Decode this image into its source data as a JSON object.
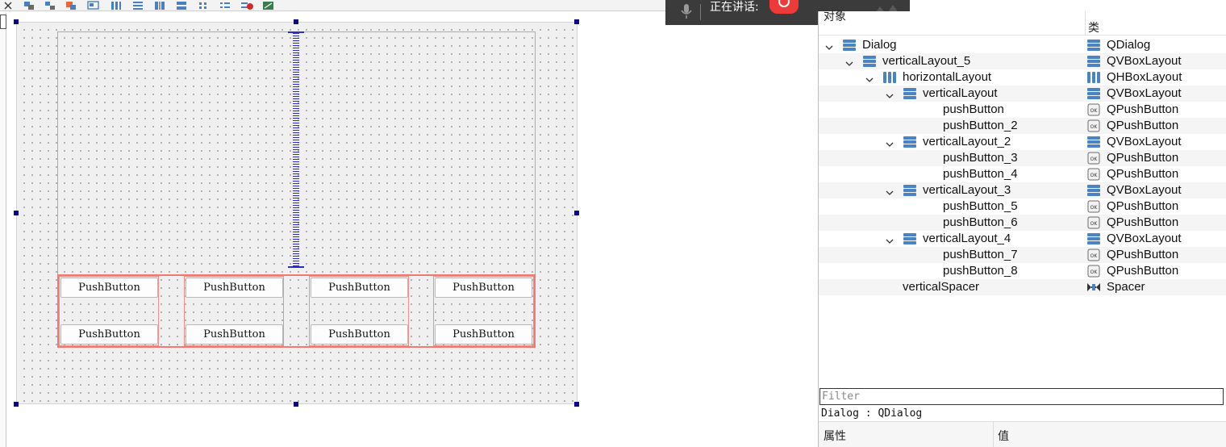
{
  "overlay": {
    "speaking_label": "正在讲话:"
  },
  "object_inspector": {
    "column_object": "对象",
    "column_class": "类",
    "rows": [
      {
        "name": "Dialog",
        "cls": "QDialog",
        "icon": "vbox-layout-icon",
        "cls_icon": "vbox-layout-icon",
        "depth": 0,
        "expanded": true
      },
      {
        "name": "verticalLayout_5",
        "cls": "QVBoxLayout",
        "icon": "vbox-layout-icon",
        "cls_icon": "vbox-layout-icon",
        "depth": 1,
        "expanded": true
      },
      {
        "name": "horizontalLayout",
        "cls": "QHBoxLayout",
        "icon": "hbox-layout-icon",
        "cls_icon": "hbox-layout-icon",
        "depth": 2,
        "expanded": true
      },
      {
        "name": "verticalLayout",
        "cls": "QVBoxLayout",
        "icon": "vbox-layout-icon",
        "cls_icon": "vbox-layout-icon",
        "depth": 3,
        "expanded": true
      },
      {
        "name": "pushButton",
        "cls": "QPushButton",
        "icon": "",
        "cls_icon": "ok-button-icon",
        "depth": 4
      },
      {
        "name": "pushButton_2",
        "cls": "QPushButton",
        "icon": "",
        "cls_icon": "ok-button-icon",
        "depth": 4
      },
      {
        "name": "verticalLayout_2",
        "cls": "QVBoxLayout",
        "icon": "vbox-layout-icon",
        "cls_icon": "vbox-layout-icon",
        "depth": 3,
        "expanded": true
      },
      {
        "name": "pushButton_3",
        "cls": "QPushButton",
        "icon": "",
        "cls_icon": "ok-button-icon",
        "depth": 4
      },
      {
        "name": "pushButton_4",
        "cls": "QPushButton",
        "icon": "",
        "cls_icon": "ok-button-icon",
        "depth": 4
      },
      {
        "name": "verticalLayout_3",
        "cls": "QVBoxLayout",
        "icon": "vbox-layout-icon",
        "cls_icon": "vbox-layout-icon",
        "depth": 3,
        "expanded": true
      },
      {
        "name": "pushButton_5",
        "cls": "QPushButton",
        "icon": "",
        "cls_icon": "ok-button-icon",
        "depth": 4
      },
      {
        "name": "pushButton_6",
        "cls": "QPushButton",
        "icon": "",
        "cls_icon": "ok-button-icon",
        "depth": 4
      },
      {
        "name": "verticalLayout_4",
        "cls": "QVBoxLayout",
        "icon": "vbox-layout-icon",
        "cls_icon": "vbox-layout-icon",
        "depth": 3,
        "expanded": true
      },
      {
        "name": "pushButton_7",
        "cls": "QPushButton",
        "icon": "",
        "cls_icon": "ok-button-icon",
        "depth": 4
      },
      {
        "name": "pushButton_8",
        "cls": "QPushButton",
        "icon": "",
        "cls_icon": "ok-button-icon",
        "depth": 4
      },
      {
        "name": "verticalSpacer",
        "cls": "Spacer",
        "icon": "",
        "cls_icon": "spacer-icon",
        "depth": 2
      }
    ]
  },
  "filter": {
    "placeholder": "Filter"
  },
  "selected_object": "Dialog : QDialog",
  "property_editor": {
    "column_property": "属性",
    "column_value": "值"
  },
  "form": {
    "buttons": [
      "PushButton",
      "PushButton",
      "PushButton",
      "PushButton",
      "PushButton",
      "PushButton",
      "PushButton",
      "PushButton"
    ]
  },
  "toolbar_icons": [
    "edit-widgets-icon",
    "edit-signals-icon",
    "edit-buddies-icon",
    "edit-tab-order-icon",
    "layout-horizontal-icon",
    "layout-vertical-icon",
    "layout-horizontal-splitter-icon",
    "layout-vertical-splitter-icon",
    "layout-grid-icon",
    "layout-form-icon",
    "break-layout-icon",
    "adjust-size-icon"
  ]
}
